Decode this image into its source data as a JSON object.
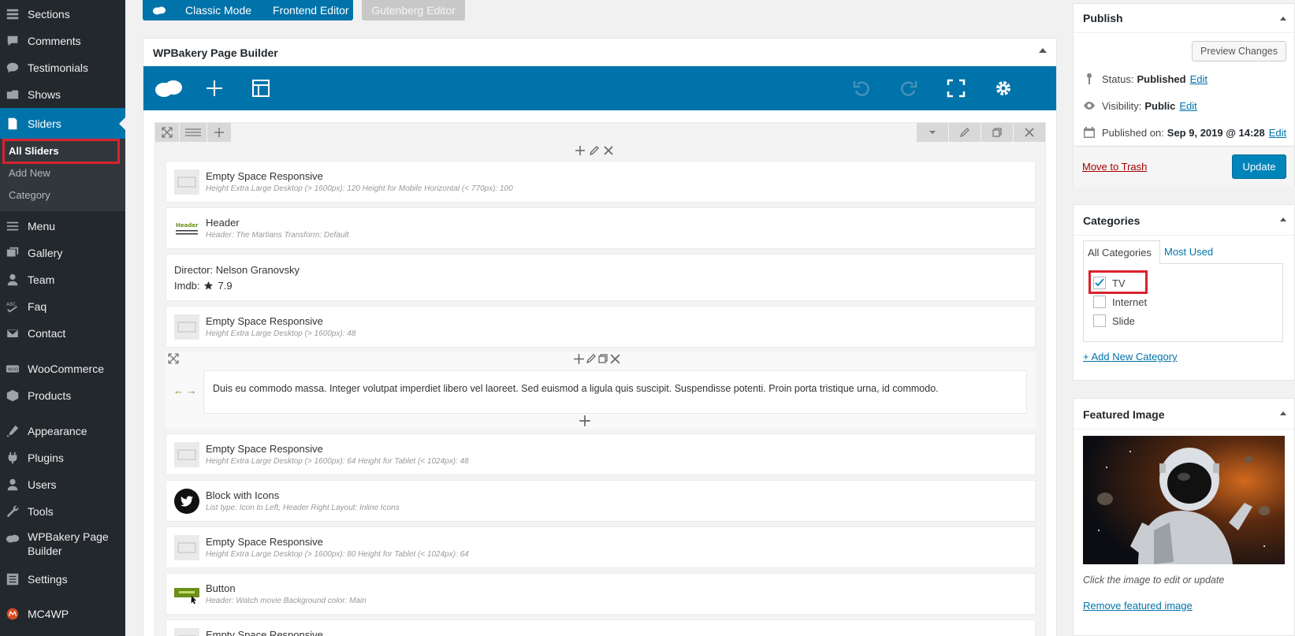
{
  "sidebar": {
    "items": [
      {
        "label": "Sections",
        "icon": "sections-icon"
      },
      {
        "label": "Comments",
        "icon": "comments-icon"
      },
      {
        "label": "Testimonials",
        "icon": "testimonials-icon"
      },
      {
        "label": "Shows",
        "icon": "shows-icon"
      },
      {
        "label": "Sliders",
        "icon": "sliders-icon"
      },
      {
        "label": "Menu",
        "icon": "menu-icon"
      },
      {
        "label": "Gallery",
        "icon": "gallery-icon"
      },
      {
        "label": "Team",
        "icon": "team-icon"
      },
      {
        "label": "Faq",
        "icon": "faq-icon"
      },
      {
        "label": "Contact",
        "icon": "contact-icon"
      },
      {
        "label": "WooCommerce",
        "icon": "woocommerce-icon"
      },
      {
        "label": "Products",
        "icon": "products-icon"
      },
      {
        "label": "Appearance",
        "icon": "appearance-icon"
      },
      {
        "label": "Plugins",
        "icon": "plugins-icon"
      },
      {
        "label": "Users",
        "icon": "users-icon"
      },
      {
        "label": "Tools",
        "icon": "tools-icon"
      },
      {
        "label": "WPBakery Page",
        "label2": "Builder",
        "icon": "wpbakery-icon"
      },
      {
        "label": "Settings",
        "icon": "settings-icon"
      },
      {
        "label": "MC4WP",
        "icon": "mc4wp-icon"
      }
    ],
    "submenu": [
      "All Sliders",
      "Add New",
      "Category"
    ]
  },
  "editor_modes": {
    "classic": "Classic Mode",
    "frontend": "Frontend Editor",
    "gutenberg": "Gutenberg Editor"
  },
  "wpbakery": {
    "title": "WPBakery Page Builder",
    "elements": [
      {
        "name": "Empty Space Responsive",
        "params": "Height Extra Large Desktop (> 1600px): 120  Height for Mobile Horizontal (< 770px): 100"
      },
      {
        "name": "Header",
        "params": "Header: The Martians  Transform: Default"
      },
      {
        "line1": "Director: Nelson Granovsky",
        "line2_label": "Imdb:",
        "line2_value": "7.9"
      },
      {
        "name": "Empty Space Responsive",
        "params": "Height Extra Large Desktop (> 1600px): 48"
      },
      {
        "text": "Duis eu commodo massa. Integer volutpat imperdiet libero vel laoreet. Sed euismod a ligula quis suscipit. Suspendisse potenti. Proin porta tristique urna, id commodo."
      },
      {
        "name": "Empty Space Responsive",
        "params": "Height Extra Large Desktop (> 1600px): 64  Height for Tablet (< 1024px): 48"
      },
      {
        "name": "Block with Icons",
        "params": "List type: Icon to Left, Header Right  Layout: Inline Icons"
      },
      {
        "name": "Empty Space Responsive",
        "params": "Height Extra Large Desktop (> 1600px): 80  Height for Tablet (< 1024px): 64"
      },
      {
        "name": "Button",
        "params": "Header: Watch movie  Background color: Main"
      },
      {
        "name": "Empty Space Responsive"
      }
    ]
  },
  "publish": {
    "title": "Publish",
    "preview": "Preview Changes",
    "status_label": "Status:",
    "status_value": "Published",
    "visibility_label": "Visibility:",
    "visibility_value": "Public",
    "published_label": "Published on:",
    "published_value": "Sep 9, 2019 @ 14:28",
    "edit": "Edit",
    "trash": "Move to Trash",
    "update": "Update"
  },
  "categories": {
    "title": "Categories",
    "tab_all": "All Categories",
    "tab_most": "Most Used",
    "items": [
      {
        "label": "TV",
        "checked": true
      },
      {
        "label": "Internet",
        "checked": false
      },
      {
        "label": "Slide",
        "checked": false
      }
    ],
    "add_new": "+ Add New Category"
  },
  "featured": {
    "title": "Featured Image",
    "hint": "Click the image to edit or update",
    "remove": "Remove featured image"
  },
  "colors": {
    "admin_bar": "#23282d",
    "accent": "#0073aa",
    "highlight": "#d9232e"
  }
}
